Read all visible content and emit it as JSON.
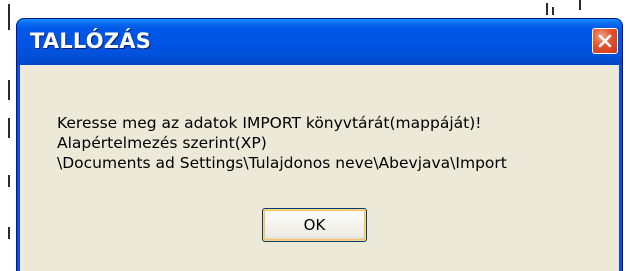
{
  "dialog": {
    "title": "TALLÓZÁS",
    "close_icon": "close-icon",
    "message_lines": [
      "Keresse meg az adatok IMPORT könyvtárát(mappáját)!",
      "Alapértelmezés szerint(XP)",
      "\\Documents ad Settings\\Tulajdonos neve\\Abevjava\\Import"
    ],
    "ok_label": "OK"
  },
  "colors": {
    "titlebar": "#0054e3",
    "client_bg": "#ece9d8",
    "close_button": "#e0532e"
  }
}
